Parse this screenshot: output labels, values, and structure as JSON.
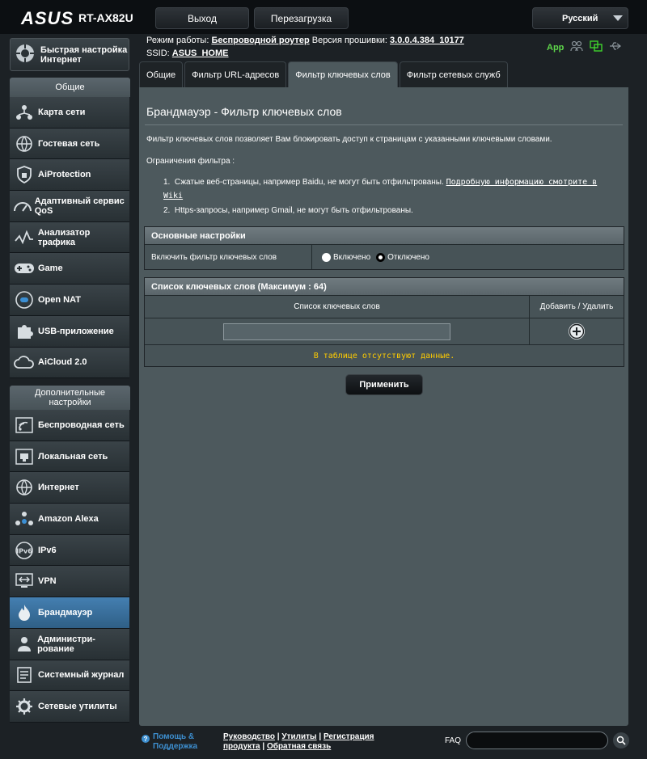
{
  "header": {
    "brand": "ASUS",
    "model": "RT-AX82U",
    "logout_label": "Выход",
    "reboot_label": "Перезагрузка",
    "language": "Русский"
  },
  "info": {
    "mode_label": "Режим работы:",
    "mode_value": "Беспроводной роутер",
    "fw_label": "Версия прошивки:",
    "fw_value": "3.0.0.4.384_10177",
    "ssid_label": "SSID:",
    "ssid_value": "ASUS_HOME",
    "app_label": "App",
    "icons": [
      "users-icon",
      "network-status-icon",
      "usb-icon"
    ]
  },
  "sidebar": {
    "quick_setup": "Быстрая настройка Интернет",
    "general_title": "Общие",
    "general_items": [
      {
        "label": "Карта сети",
        "icon": "network-map-icon"
      },
      {
        "label": "Гостевая сеть",
        "icon": "guest-network-icon"
      },
      {
        "label": "AiProtection",
        "icon": "shield-icon"
      },
      {
        "label": "Адаптивный сервис QoS",
        "icon": "gauge-icon"
      },
      {
        "label": "Анализатор трафика",
        "icon": "traffic-analyzer-icon"
      },
      {
        "label": "Game",
        "icon": "gamepad-icon"
      },
      {
        "label": "Open NAT",
        "icon": "open-nat-icon"
      },
      {
        "label": "USB-приложение",
        "icon": "puzzle-icon"
      },
      {
        "label": "AiCloud 2.0",
        "icon": "cloud-icon"
      }
    ],
    "advanced_title": "Дополнительные настройки",
    "advanced_items": [
      {
        "label": "Беспроводная сеть",
        "icon": "wireless-icon"
      },
      {
        "label": "Локальная сеть",
        "icon": "lan-icon"
      },
      {
        "label": "Интернет",
        "icon": "globe-icon"
      },
      {
        "label": "Amazon Alexa",
        "icon": "alexa-icon"
      },
      {
        "label": "IPv6",
        "icon": "ipv6-icon"
      },
      {
        "label": "VPN",
        "icon": "vpn-icon"
      },
      {
        "label": "Брандмауэр",
        "icon": "firewall-icon"
      },
      {
        "label": "Администри-рование",
        "icon": "admin-icon"
      },
      {
        "label": "Системный журнал",
        "icon": "syslog-icon"
      },
      {
        "label": "Сетевые утилиты",
        "icon": "gear-icon"
      }
    ],
    "active_item": "Брандмауэр"
  },
  "tabs": [
    {
      "label": "Общие"
    },
    {
      "label": "Фильтр URL-адресов"
    },
    {
      "label": "Фильтр ключевых слов"
    },
    {
      "label": "Фильтр сетевых служб"
    }
  ],
  "content": {
    "title": "Брандмауэр - Фильтр ключевых слов",
    "description": "Фильтр ключевых слов позволяет Вам блокировать доступ к страницам с указанными ключевыми словами.",
    "limits_title": "Ограничения фильтра :",
    "limit1": "Сжатые веб-страницы, например Baidu, не могут быть отфильтрованы.",
    "limit1_link": "Подробную информацию смотрите в Wiki",
    "limit2": "Https-запросы, например Gmail, не могут быть отфильтрованы.",
    "basic_header": "Основные настройки",
    "enable_label": "Включить фильтр ключевых слов",
    "on_label": "Включено",
    "off_label": "Отключено",
    "list_header": "Список ключевых слов (Максимум : 64)",
    "col_list": "Список ключевых слов",
    "col_action": "Добавить / Удалить",
    "keyword_value": "",
    "empty_text": "В таблице отсутствуют данные.",
    "apply_label": "Применить"
  },
  "footer": {
    "help_line1": "Помощь &",
    "help_line2": "Поддержка",
    "manual": "Руководство",
    "utilities": "Утилиты",
    "registration": "Регистрация",
    "product": "продукта",
    "feedback": "Обратная связь",
    "faq_label": "FAQ",
    "faq_value": ""
  }
}
